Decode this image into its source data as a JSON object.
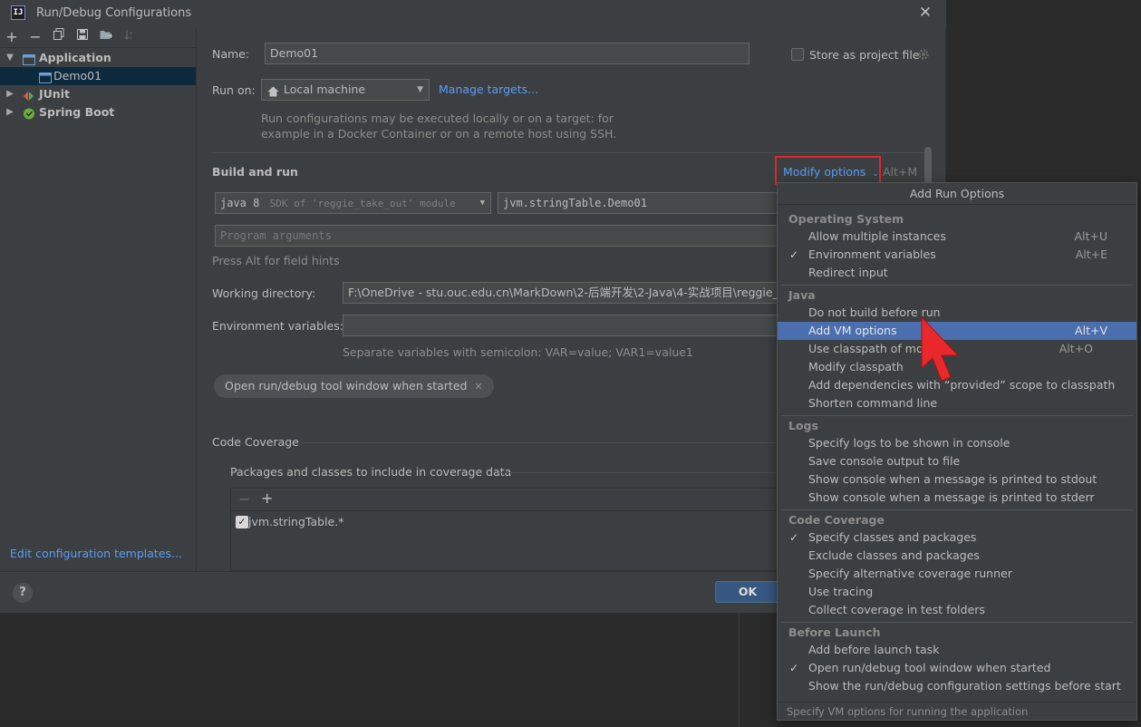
{
  "window": {
    "title": "Run/Debug Configurations",
    "app_icon": "IJ"
  },
  "sidebar": {
    "items": [
      {
        "label": "Application",
        "icon": "application-icon",
        "expanded": true
      },
      {
        "label": "Demo01",
        "icon": "class-config-icon",
        "selected": true
      },
      {
        "label": "JUnit",
        "icon": "junit-icon",
        "expanded": false
      },
      {
        "label": "Spring Boot",
        "icon": "spring-boot-icon",
        "expanded": false
      }
    ],
    "edit_templates": "Edit configuration templates..."
  },
  "form": {
    "name_label": "Name:",
    "name_value": "Demo01",
    "store_label": "Store as project file",
    "run_on_label": "Run on:",
    "run_on_value": "Local machine",
    "manage_targets": "Manage targets...",
    "run_on_hint_1": "Run configurations may be executed locally or on a target: for",
    "run_on_hint_2": "example in a Docker Container or on a remote host using SSH.",
    "build_run_title": "Build and run",
    "modify_options": "Modify options",
    "modify_shortcut": "Alt+M",
    "sdk_java": "java 8",
    "sdk_detail": "SDK of 'reggie_take_out' module",
    "main_class": "jvm.stringTable.Demo01",
    "program_args_placeholder": "Program arguments",
    "field_hints": "Press Alt for field hints",
    "working_dir_label": "Working directory:",
    "working_dir_value": "F:\\OneDrive - stu.ouc.edu.cn\\MarkDown\\2-后端开发\\2-Java\\4-实战项目\\reggie_take",
    "env_label": "Environment variables:",
    "env_hint": "Separate variables with semicolon: VAR=value; VAR1=value1",
    "chip_label": "Open run/debug tool window when started",
    "code_coverage_title": "Code Coverage",
    "coverage_subtitle": "Packages and classes to include in coverage data",
    "coverage_item": "jvm.stringTable.*"
  },
  "buttons": {
    "ok": "OK",
    "help": "?"
  },
  "popup": {
    "title": "Add Run Options",
    "footer": "Specify VM options for running the application",
    "groups": [
      {
        "header": "Operating System",
        "items": [
          {
            "label": "Allow multiple instances",
            "shortcut": "Alt+U",
            "checked": false
          },
          {
            "label": "Environment variables",
            "shortcut": "Alt+E",
            "checked": true
          },
          {
            "label": "Redirect input",
            "shortcut": "",
            "checked": false
          }
        ]
      },
      {
        "header": "Java",
        "items": [
          {
            "label": "Do not build before run",
            "shortcut": "",
            "checked": false
          },
          {
            "label": "Add VM options",
            "shortcut": "Alt+V",
            "checked": false,
            "selected": true
          },
          {
            "label": "Use classpath of mod",
            "shortcut": "Alt+O",
            "checked": false
          },
          {
            "label": "Modify classpath",
            "shortcut": "",
            "checked": false
          },
          {
            "label": "Add dependencies with “provided” scope to classpath",
            "shortcut": "",
            "checked": false
          },
          {
            "label": "Shorten command line",
            "shortcut": "",
            "checked": false
          }
        ]
      },
      {
        "header": "Logs",
        "items": [
          {
            "label": "Specify logs to be shown in console",
            "shortcut": "",
            "checked": false
          },
          {
            "label": "Save console output to file",
            "shortcut": "",
            "checked": false
          },
          {
            "label": "Show console when a message is printed to stdout",
            "shortcut": "",
            "checked": false
          },
          {
            "label": "Show console when a message is printed to stderr",
            "shortcut": "",
            "checked": false
          }
        ]
      },
      {
        "header": "Code Coverage",
        "items": [
          {
            "label": "Specify classes and packages",
            "shortcut": "",
            "checked": true
          },
          {
            "label": "Exclude classes and packages",
            "shortcut": "",
            "checked": false
          },
          {
            "label": "Specify alternative coverage runner",
            "shortcut": "",
            "checked": false
          },
          {
            "label": "Use tracing",
            "shortcut": "",
            "checked": false
          },
          {
            "label": "Collect coverage in test folders",
            "shortcut": "",
            "checked": false
          }
        ]
      },
      {
        "header": "Before Launch",
        "items": [
          {
            "label": "Add before launch task",
            "shortcut": "",
            "checked": false
          },
          {
            "label": "Open run/debug tool window when started",
            "shortcut": "",
            "checked": true
          },
          {
            "label": "Show the run/debug configuration settings before start",
            "shortcut": "",
            "checked": false
          }
        ]
      }
    ]
  },
  "colors": {
    "accent": "#589df6",
    "selection": "#4b6eaf",
    "highlight_box": "#e0262a",
    "cursor": "#e8282b"
  }
}
